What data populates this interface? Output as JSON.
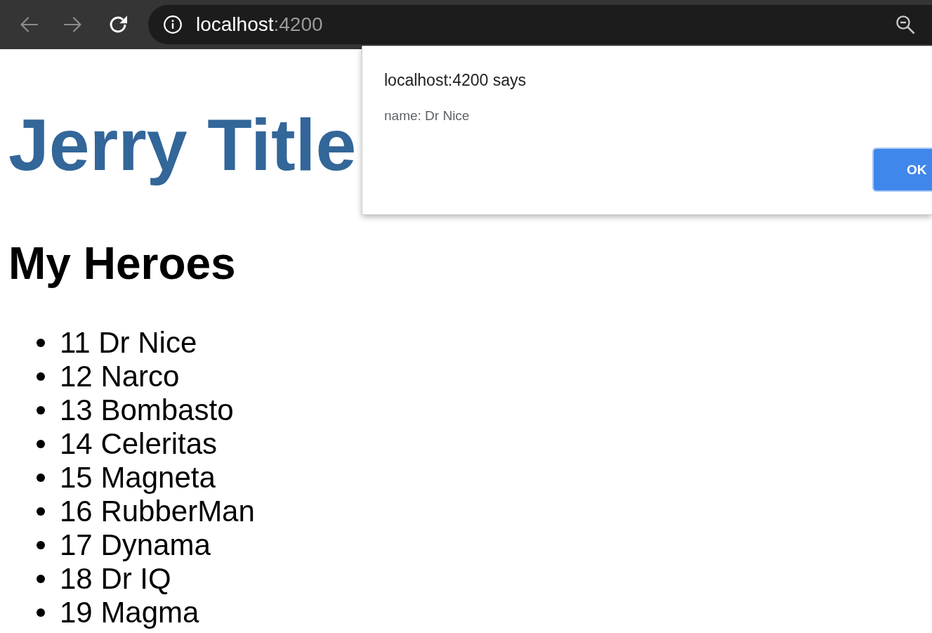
{
  "browser_toolbar": {
    "nav_buttons": [
      {
        "kind": "back",
        "disabled": true
      },
      {
        "kind": "forward",
        "disabled": true
      },
      {
        "kind": "reload",
        "disabled": false
      }
    ],
    "address_bar": {
      "host": "localhost",
      "port": ":4200"
    }
  },
  "page": {
    "title": "Jerry Title",
    "heading": "My Heroes",
    "heroes": [
      "11 Dr Nice",
      "12 Narco",
      "13 Bombasto",
      "14 Celeritas",
      "15 Magneta",
      "16 RubberMan",
      "17 Dynama",
      "18 Dr IQ",
      "19 Magma"
    ]
  },
  "alert_dialog": {
    "title": "localhost:4200 says",
    "message": "name: Dr Nice",
    "buttons": [
      "OK"
    ]
  }
}
